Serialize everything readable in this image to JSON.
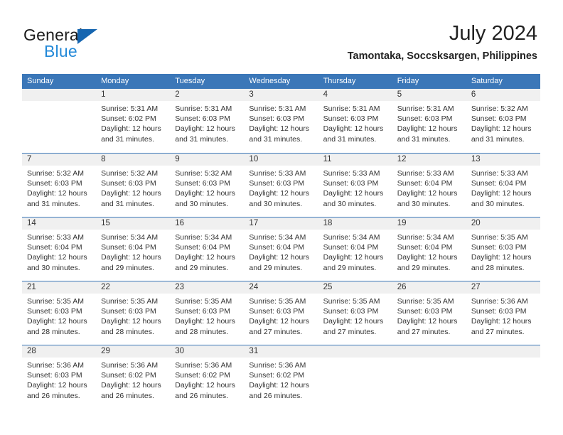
{
  "brand": {
    "name_top": "General",
    "name_bottom": "Blue",
    "accent_dark": "#1565B0",
    "accent_light": "#2389D8"
  },
  "header": {
    "title": "July 2024",
    "subtitle": "Tamontaka, Soccsksargen, Philippines"
  },
  "theme": {
    "header_blue": "#3B77B8",
    "daynum_band": "#F0F0F0",
    "text": "#333333"
  },
  "weekdays": [
    "Sunday",
    "Monday",
    "Tuesday",
    "Wednesday",
    "Thursday",
    "Friday",
    "Saturday"
  ],
  "weeks": [
    [
      {
        "day": "",
        "lines": []
      },
      {
        "day": "1",
        "lines": [
          "Sunrise: 5:31 AM",
          "Sunset: 6:02 PM",
          "Daylight: 12 hours",
          "and 31 minutes."
        ]
      },
      {
        "day": "2",
        "lines": [
          "Sunrise: 5:31 AM",
          "Sunset: 6:03 PM",
          "Daylight: 12 hours",
          "and 31 minutes."
        ]
      },
      {
        "day": "3",
        "lines": [
          "Sunrise: 5:31 AM",
          "Sunset: 6:03 PM",
          "Daylight: 12 hours",
          "and 31 minutes."
        ]
      },
      {
        "day": "4",
        "lines": [
          "Sunrise: 5:31 AM",
          "Sunset: 6:03 PM",
          "Daylight: 12 hours",
          "and 31 minutes."
        ]
      },
      {
        "day": "5",
        "lines": [
          "Sunrise: 5:31 AM",
          "Sunset: 6:03 PM",
          "Daylight: 12 hours",
          "and 31 minutes."
        ]
      },
      {
        "day": "6",
        "lines": [
          "Sunrise: 5:32 AM",
          "Sunset: 6:03 PM",
          "Daylight: 12 hours",
          "and 31 minutes."
        ]
      }
    ],
    [
      {
        "day": "7",
        "lines": [
          "Sunrise: 5:32 AM",
          "Sunset: 6:03 PM",
          "Daylight: 12 hours",
          "and 31 minutes."
        ]
      },
      {
        "day": "8",
        "lines": [
          "Sunrise: 5:32 AM",
          "Sunset: 6:03 PM",
          "Daylight: 12 hours",
          "and 31 minutes."
        ]
      },
      {
        "day": "9",
        "lines": [
          "Sunrise: 5:32 AM",
          "Sunset: 6:03 PM",
          "Daylight: 12 hours",
          "and 30 minutes."
        ]
      },
      {
        "day": "10",
        "lines": [
          "Sunrise: 5:33 AM",
          "Sunset: 6:03 PM",
          "Daylight: 12 hours",
          "and 30 minutes."
        ]
      },
      {
        "day": "11",
        "lines": [
          "Sunrise: 5:33 AM",
          "Sunset: 6:03 PM",
          "Daylight: 12 hours",
          "and 30 minutes."
        ]
      },
      {
        "day": "12",
        "lines": [
          "Sunrise: 5:33 AM",
          "Sunset: 6:04 PM",
          "Daylight: 12 hours",
          "and 30 minutes."
        ]
      },
      {
        "day": "13",
        "lines": [
          "Sunrise: 5:33 AM",
          "Sunset: 6:04 PM",
          "Daylight: 12 hours",
          "and 30 minutes."
        ]
      }
    ],
    [
      {
        "day": "14",
        "lines": [
          "Sunrise: 5:33 AM",
          "Sunset: 6:04 PM",
          "Daylight: 12 hours",
          "and 30 minutes."
        ]
      },
      {
        "day": "15",
        "lines": [
          "Sunrise: 5:34 AM",
          "Sunset: 6:04 PM",
          "Daylight: 12 hours",
          "and 29 minutes."
        ]
      },
      {
        "day": "16",
        "lines": [
          "Sunrise: 5:34 AM",
          "Sunset: 6:04 PM",
          "Daylight: 12 hours",
          "and 29 minutes."
        ]
      },
      {
        "day": "17",
        "lines": [
          "Sunrise: 5:34 AM",
          "Sunset: 6:04 PM",
          "Daylight: 12 hours",
          "and 29 minutes."
        ]
      },
      {
        "day": "18",
        "lines": [
          "Sunrise: 5:34 AM",
          "Sunset: 6:04 PM",
          "Daylight: 12 hours",
          "and 29 minutes."
        ]
      },
      {
        "day": "19",
        "lines": [
          "Sunrise: 5:34 AM",
          "Sunset: 6:04 PM",
          "Daylight: 12 hours",
          "and 29 minutes."
        ]
      },
      {
        "day": "20",
        "lines": [
          "Sunrise: 5:35 AM",
          "Sunset: 6:03 PM",
          "Daylight: 12 hours",
          "and 28 minutes."
        ]
      }
    ],
    [
      {
        "day": "21",
        "lines": [
          "Sunrise: 5:35 AM",
          "Sunset: 6:03 PM",
          "Daylight: 12 hours",
          "and 28 minutes."
        ]
      },
      {
        "day": "22",
        "lines": [
          "Sunrise: 5:35 AM",
          "Sunset: 6:03 PM",
          "Daylight: 12 hours",
          "and 28 minutes."
        ]
      },
      {
        "day": "23",
        "lines": [
          "Sunrise: 5:35 AM",
          "Sunset: 6:03 PM",
          "Daylight: 12 hours",
          "and 28 minutes."
        ]
      },
      {
        "day": "24",
        "lines": [
          "Sunrise: 5:35 AM",
          "Sunset: 6:03 PM",
          "Daylight: 12 hours",
          "and 27 minutes."
        ]
      },
      {
        "day": "25",
        "lines": [
          "Sunrise: 5:35 AM",
          "Sunset: 6:03 PM",
          "Daylight: 12 hours",
          "and 27 minutes."
        ]
      },
      {
        "day": "26",
        "lines": [
          "Sunrise: 5:35 AM",
          "Sunset: 6:03 PM",
          "Daylight: 12 hours",
          "and 27 minutes."
        ]
      },
      {
        "day": "27",
        "lines": [
          "Sunrise: 5:36 AM",
          "Sunset: 6:03 PM",
          "Daylight: 12 hours",
          "and 27 minutes."
        ]
      }
    ],
    [
      {
        "day": "28",
        "lines": [
          "Sunrise: 5:36 AM",
          "Sunset: 6:03 PM",
          "Daylight: 12 hours",
          "and 26 minutes."
        ]
      },
      {
        "day": "29",
        "lines": [
          "Sunrise: 5:36 AM",
          "Sunset: 6:02 PM",
          "Daylight: 12 hours",
          "and 26 minutes."
        ]
      },
      {
        "day": "30",
        "lines": [
          "Sunrise: 5:36 AM",
          "Sunset: 6:02 PM",
          "Daylight: 12 hours",
          "and 26 minutes."
        ]
      },
      {
        "day": "31",
        "lines": [
          "Sunrise: 5:36 AM",
          "Sunset: 6:02 PM",
          "Daylight: 12 hours",
          "and 26 minutes."
        ]
      },
      {
        "day": "",
        "lines": []
      },
      {
        "day": "",
        "lines": []
      },
      {
        "day": "",
        "lines": []
      }
    ]
  ]
}
